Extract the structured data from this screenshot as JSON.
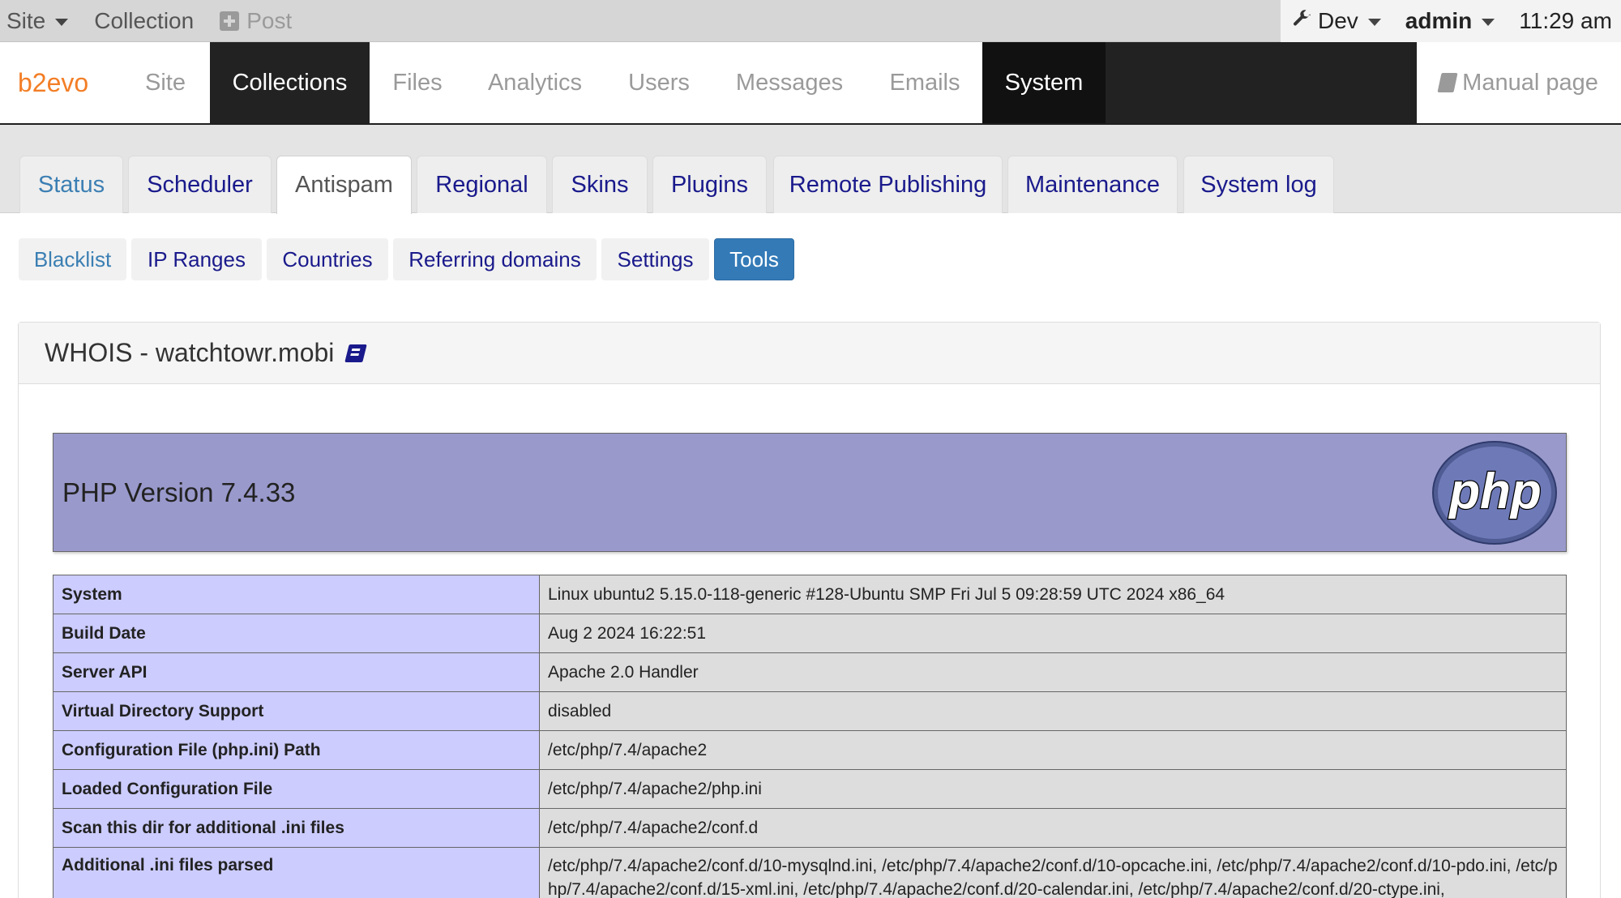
{
  "evobar": {
    "site": "Site",
    "collection": "Collection",
    "post": "Post",
    "dev": "Dev",
    "user": "admin",
    "time": "11:29 am"
  },
  "mainnav": {
    "brand": "b2evo",
    "items": [
      "Site",
      "Collections",
      "Files",
      "Analytics",
      "Users",
      "Messages",
      "Emails",
      "System"
    ],
    "manual": "Manual page"
  },
  "tabs": [
    "Status",
    "Scheduler",
    "Antispam",
    "Regional",
    "Skins",
    "Plugins",
    "Remote Publishing",
    "Maintenance",
    "System log"
  ],
  "subtabs": [
    "Blacklist",
    "IP Ranges",
    "Countries",
    "Referring domains",
    "Settings",
    "Tools"
  ],
  "panel": {
    "title": "WHOIS - watchtowr.mobi"
  },
  "phpinfo": {
    "version": "PHP Version 7.4.33",
    "logo_text": "php",
    "rows": [
      {
        "key": "System",
        "value": "Linux ubuntu2 5.15.0-118-generic #128-Ubuntu SMP Fri Jul 5 09:28:59 UTC 2024 x86_64"
      },
      {
        "key": "Build Date",
        "value": "Aug 2 2024 16:22:51"
      },
      {
        "key": "Server API",
        "value": "Apache 2.0 Handler"
      },
      {
        "key": "Virtual Directory Support",
        "value": "disabled"
      },
      {
        "key": "Configuration File (php.ini) Path",
        "value": "/etc/php/7.4/apache2"
      },
      {
        "key": "Loaded Configuration File",
        "value": "/etc/php/7.4/apache2/php.ini"
      },
      {
        "key": "Scan this dir for additional .ini files",
        "value": "/etc/php/7.4/apache2/conf.d"
      },
      {
        "key": "Additional .ini files parsed",
        "value": "/etc/php/7.4/apache2/conf.d/10-mysqlnd.ini, /etc/php/7.4/apache2/conf.d/10-opcache.ini, /etc/php/7.4/apache2/conf.d/10-pdo.ini, /etc/php/7.4/apache2/conf.d/15-xml.ini, /etc/php/7.4/apache2/conf.d/20-calendar.ini, /etc/php/7.4/apache2/conf.d/20-ctype.ini,"
      }
    ]
  },
  "colors": {
    "brand": "#f37e26",
    "nav_dark": "#222222",
    "link": "#1a1a8c",
    "pill_active": "#337ab7",
    "php_header": "#9999cc",
    "php_key_bg": "#ccccff",
    "php_val_bg": "#dddddd"
  }
}
